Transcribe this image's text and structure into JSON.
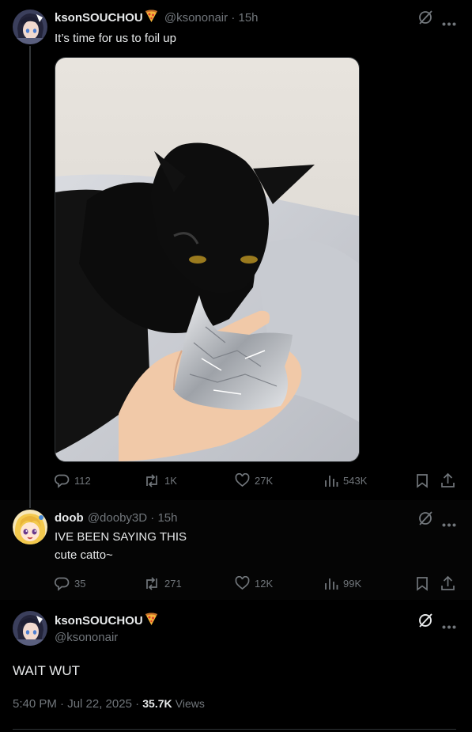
{
  "tweets": [
    {
      "display_name": "ksonSOUCHOU",
      "handle": "@ksononair",
      "time": "· 15h",
      "text": "It’s time for us to foil up",
      "stats": {
        "replies": "112",
        "reposts": "1K",
        "likes": "27K",
        "views": "543K"
      }
    },
    {
      "display_name": "doob",
      "handle": "@dooby3D",
      "time": "· 15h",
      "text_lines": [
        "IVE BEEN SAYING THIS",
        "cute catto~"
      ],
      "stats": {
        "replies": "35",
        "reposts": "271",
        "likes": "12K",
        "views": "99K"
      }
    }
  ],
  "focused": {
    "display_name": "ksonSOUCHOU",
    "handle": "@ksononair",
    "text": "WAIT WUT",
    "timestamp": "5:40 PM · Jul 22, 2025 ·",
    "views_count": "35.7K",
    "views_label": "Views"
  },
  "icons": {
    "grok": "grok-icon",
    "more": "more-icon",
    "reply": "reply-icon",
    "repost": "repost-icon",
    "like": "heart-icon",
    "views": "views-icon",
    "bookmark": "bookmark-icon",
    "share": "share-icon",
    "emoji": "pizza-emoji"
  },
  "colors": {
    "background": "#000000",
    "text": "#e7e9ea",
    "muted": "#71767b",
    "border": "#2f3336"
  }
}
